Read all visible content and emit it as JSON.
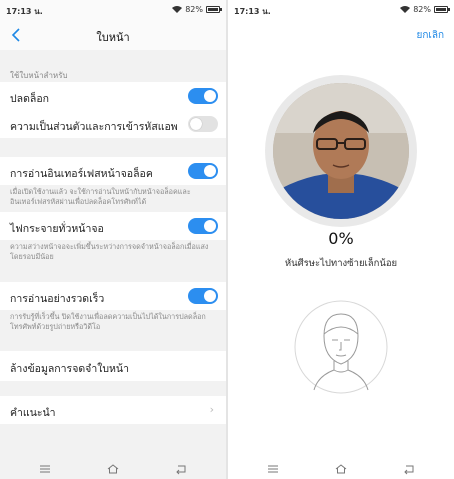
{
  "status_bar": {
    "time": "17:13 น.",
    "battery": "82%",
    "battery_level": 0.82
  },
  "left_screen": {
    "title": "ใบหน้า",
    "section_label": "ใช้ใบหน้าสำหรับ",
    "settings": {
      "unlock": {
        "label": "ปลดล็อก",
        "enabled": true
      },
      "privacy": {
        "label": "ความเป็นส่วนตัวและการเข้ารหัสแอพ",
        "enabled": false
      },
      "interface": {
        "label": "การอ่านอินเทอร์เฟสหน้าจอล็อค",
        "enabled": true,
        "description": "เมื่อเปิดใช้งานแล้ว จะใช้การอ่านใบหน้ากับหน้าจอล็อคและอินเทอร์เฟสรหัสผ่านเพื่อปลดล็อคโทรศัพท์ได้"
      },
      "flash": {
        "label": "ไฟกระจายทั่วหน้าจอ",
        "enabled": true,
        "description": "ความสว่างหน้าจอจะเพิ่มขึ้นระหว่างการจดจำหน้าจอล็อกเมื่อแสงโดยรอบมีน้อย"
      },
      "fast": {
        "label": "การอ่านอย่างรวดเร็ว",
        "enabled": true,
        "description": "การรับรู้ที่เร็วขึ้น ปิดใช้งานเพื่อลดความเป็นไปได้ในการปลดล็อกโทรศัพท์ด้วยรูปถ่ายหรือวิดีโอ"
      }
    },
    "clear_label": "ล้างข้อมูลการจดจำใบหน้า",
    "tips_label": "คำแนะนำ"
  },
  "right_screen": {
    "cancel_label": "ยกเลิก",
    "progress_label": "0%",
    "progress": 0,
    "hint": "หันศีรษะไปทางซ้ายเล็กน้อย"
  },
  "icons": {
    "back": "chevron-left-icon",
    "wifi": "wifi-icon",
    "battery": "battery-icon",
    "menu": "menu-icon",
    "home": "home-icon",
    "return": "return-icon",
    "chevron": "chevron-right-icon"
  },
  "colors": {
    "accent": "#2c8ef0",
    "toggle_off": "#e2e2e2",
    "link": "#1e88e5"
  }
}
